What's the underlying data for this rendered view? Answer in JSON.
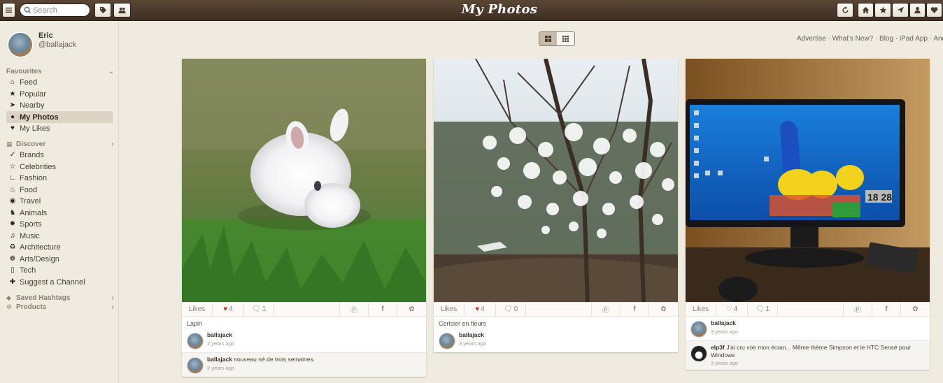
{
  "topbar": {
    "title": "My Photos",
    "search_placeholder": "Search"
  },
  "profile": {
    "name": "Eric",
    "handle": "@ballajack"
  },
  "favourites": {
    "heading": "Favourites",
    "items": [
      {
        "label": "Feed",
        "icon": "home-icon"
      },
      {
        "label": "Popular",
        "icon": "star-icon"
      },
      {
        "label": "Nearby",
        "icon": "location-arrow-icon"
      },
      {
        "label": "My Photos",
        "icon": "user-icon",
        "active": true
      },
      {
        "label": "My Likes",
        "icon": "heart-icon"
      }
    ]
  },
  "discover": {
    "heading": "Discover",
    "items": [
      {
        "label": "Brands",
        "icon": "swoosh-icon"
      },
      {
        "label": "Celebrities",
        "icon": "star-outline-icon"
      },
      {
        "label": "Fashion",
        "icon": "heel-icon"
      },
      {
        "label": "Food",
        "icon": "cake-icon"
      },
      {
        "label": "Travel",
        "icon": "globe-icon"
      },
      {
        "label": "Animals",
        "icon": "dog-icon"
      },
      {
        "label": "Sports",
        "icon": "ball-icon"
      },
      {
        "label": "Music",
        "icon": "guitar-icon"
      },
      {
        "label": "Architecture",
        "icon": "building-icon"
      },
      {
        "label": "Arts/Design",
        "icon": "palette-icon"
      },
      {
        "label": "Tech",
        "icon": "phone-icon"
      },
      {
        "label": "Suggest a Channel",
        "icon": "plus-icon"
      }
    ]
  },
  "saved_hashtags": {
    "heading": "Saved Hashtags"
  },
  "products": {
    "heading": "Products"
  },
  "toplinks": "Advertise · What's New? · Blog · iPad App · And",
  "cards": [
    {
      "likes_label": "Likes",
      "hearts": "4",
      "comments": "1",
      "caption": "Lapin",
      "comments_list": [
        {
          "user": "ballajack",
          "text": "",
          "time": "2 years ago"
        },
        {
          "user": "ballajack",
          "text": "nouveau né de trois semaines.",
          "time": "2 years ago"
        }
      ]
    },
    {
      "likes_label": "Likes",
      "hearts": "4",
      "comments": "0",
      "caption": "Cerisier en fleurs",
      "comments_list": [
        {
          "user": "ballajack",
          "text": "",
          "time": "3 years ago"
        }
      ]
    },
    {
      "likes_label": "Likes",
      "hearts": "4",
      "comments": "1",
      "caption": "",
      "comments_list": [
        {
          "user": "ballajack",
          "text": "",
          "time": "3 years ago"
        },
        {
          "user": "elp3f",
          "text": "J'ai cru voir mon écran... Même thème Simpson et le HTC Sensé pour Windows",
          "time": "3 years ago"
        }
      ]
    }
  ],
  "screen_clock": "18 28",
  "colors": {
    "topbar": "#4b3a2b",
    "background": "#efebe0",
    "heart": "#c0392b"
  }
}
